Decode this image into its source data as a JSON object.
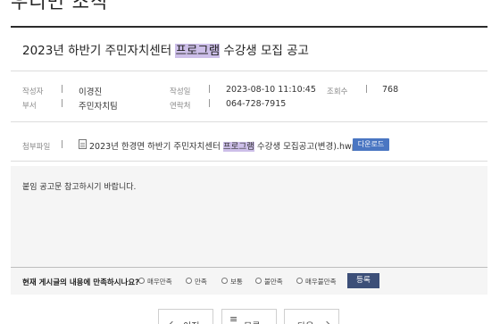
{
  "page": {
    "section_title": "우리면 조직"
  },
  "post": {
    "title_before": "2023년 하반기 주민자치센터 ",
    "title_highlight": "프로그램",
    "title_after": " 수강생 모집 공고"
  },
  "meta": {
    "author_label": "작성자",
    "author": "이경진",
    "date_label": "작성일",
    "date": "2023-08-10 11:10:45",
    "views_label": "조회수",
    "views": "768",
    "dept_label": "부서",
    "dept": "주민자치팀",
    "contact_label": "연락처",
    "contact": "064-728-7915",
    "separator": "|"
  },
  "attachment": {
    "label": "첨부파일",
    "name_before": "2023년 한경면 하반기 주민자치센터 ",
    "name_highlight": "프로그램",
    "name_after": " 수강생 모집공고(변경).hwp",
    "download_label": "다운로드"
  },
  "content": {
    "body": "붙임 공고문 참고하시기 바랍니다."
  },
  "survey": {
    "question": "현재 게시글의 내용에 만족하시나요?",
    "options": [
      "매우만족",
      "만족",
      "보통",
      "불만족",
      "매우불만족"
    ],
    "submit_label": "등록"
  },
  "nav": {
    "prev_label": "이전",
    "list_label": "목록",
    "next_label": "다음"
  },
  "colors": {
    "highlight": "#cdbfe9",
    "download": "#4a76c2",
    "submit": "#3c4f78"
  }
}
